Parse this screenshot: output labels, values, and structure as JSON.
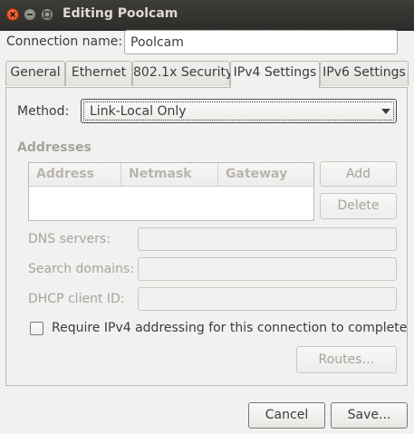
{
  "window": {
    "title": "Editing Poolcam"
  },
  "connection": {
    "label": "Connection name:",
    "value": "Poolcam"
  },
  "tabs": [
    {
      "label": "General",
      "active": false
    },
    {
      "label": "Ethernet",
      "active": false
    },
    {
      "label": "802.1x Security",
      "active": false
    },
    {
      "label": "IPv4 Settings",
      "active": true
    },
    {
      "label": "IPv6 Settings",
      "active": false
    }
  ],
  "ipv4": {
    "method_label": "Method:",
    "method_value": "Link-Local Only",
    "addresses_label": "Addresses",
    "columns": [
      "Address",
      "Netmask",
      "Gateway"
    ],
    "rows": [],
    "add_label": "Add",
    "delete_label": "Delete",
    "dns_label": "DNS servers:",
    "dns_value": "",
    "search_label": "Search domains:",
    "search_value": "",
    "dhcp_label": "DHCP client ID:",
    "dhcp_value": "",
    "require_label": "Require IPv4 addressing for this connection to complete",
    "require_checked": false,
    "routes_label": "Routes…"
  },
  "footer": {
    "cancel_label": "Cancel",
    "save_label": "Save..."
  },
  "icons": {
    "close": "close-icon",
    "minimize": "minimize-icon",
    "maximize": "maximize-icon",
    "dropdown": "chevron-down-icon"
  },
  "colors": {
    "titlebar": "#3a3935",
    "close_button": "#e9571f",
    "window_bg": "#f2f1f0",
    "disabled_text": "#a6a39e",
    "text": "#3c3c3c"
  }
}
